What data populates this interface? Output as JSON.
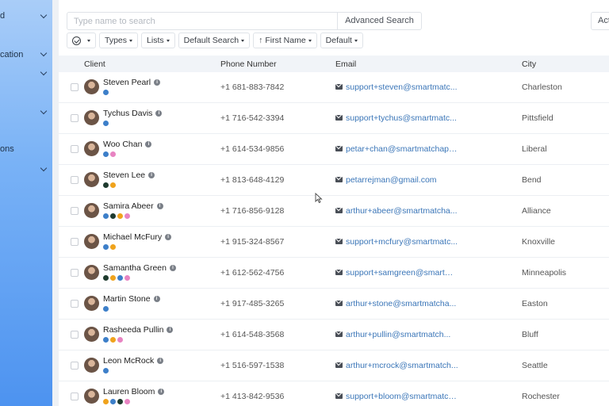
{
  "sidebar": {
    "items": [
      {
        "label": "d",
        "chevron": true
      },
      {
        "label": "cation",
        "chevron": true
      },
      {
        "label": "",
        "chevron": true
      },
      {
        "label": "",
        "chevron": true
      },
      {
        "label": "ons",
        "chevron": false
      },
      {
        "label": "",
        "chevron": true
      }
    ]
  },
  "search": {
    "placeholder": "Type name to search",
    "advanced_label": "Advanced Search"
  },
  "action_label": "Actions",
  "filters": [
    "Types",
    "Lists",
    "Default Search",
    "First Name",
    "Default"
  ],
  "columns": {
    "client": "Client",
    "phone": "Phone Number",
    "email": "Email",
    "city": "City"
  },
  "colors": {
    "blue": "#3d7fc9",
    "dark": "#1e3b2f",
    "orange": "#f0a31c",
    "pink": "#e884c2"
  },
  "rows": [
    {
      "name": "Steven Pearl",
      "phone": "+1 681-883-7842",
      "email": "support+steven@smartmatc...",
      "city": "Charleston",
      "tags": [
        "blue"
      ]
    },
    {
      "name": "Tychus Davis",
      "phone": "+1 716-542-3394",
      "email": "support+tychus@smartmatc...",
      "city": "Pittsfield",
      "tags": [
        "blue"
      ]
    },
    {
      "name": "Woo Chan",
      "phone": "+1 614-534-9856",
      "email": "petar+chan@smartmatchapp...",
      "city": "Liberal",
      "tags": [
        "blue",
        "pink"
      ]
    },
    {
      "name": "Steven Lee",
      "phone": "+1 813-648-4129",
      "email": "petarrejman@gmail.com",
      "city": "Bend",
      "tags": [
        "dark",
        "orange"
      ]
    },
    {
      "name": "Samira Abeer",
      "phone": "+1 716-856-9128",
      "email": "arthur+abeer@smartmatcha...",
      "city": "Alliance",
      "tags": [
        "blue",
        "dark",
        "orange",
        "pink"
      ]
    },
    {
      "name": "Michael McFury",
      "phone": "+1 915-324-8567",
      "email": "support+mcfury@smartmatc...",
      "city": "Knoxville",
      "tags": [
        "blue",
        "orange"
      ]
    },
    {
      "name": "Samantha Green",
      "phone": "+1 612-562-4756",
      "email": "support+samgreen@smartma...",
      "city": "Minneapolis",
      "tags": [
        "dark",
        "orange",
        "blue",
        "pink"
      ]
    },
    {
      "name": "Martin Stone",
      "phone": "+1 917-485-3265",
      "email": "arthur+stone@smartmatcha...",
      "city": "Easton",
      "tags": [
        "blue"
      ]
    },
    {
      "name": "Rasheeda Pullin",
      "phone": "+1 614-548-3568",
      "email": "arthur+pullin@smartmatch...",
      "city": "Bluff",
      "tags": [
        "blue",
        "orange",
        "pink"
      ]
    },
    {
      "name": "Leon McRock",
      "phone": "+1 516-597-1538",
      "email": "arthur+mcrock@smartmatch...",
      "city": "Seattle",
      "tags": [
        "blue"
      ]
    },
    {
      "name": "Lauren Bloom",
      "phone": "+1 413-842-9536",
      "email": "support+bloom@smartmatch...",
      "city": "Rochester",
      "tags": [
        "orange",
        "blue",
        "dark",
        "pink"
      ]
    }
  ]
}
